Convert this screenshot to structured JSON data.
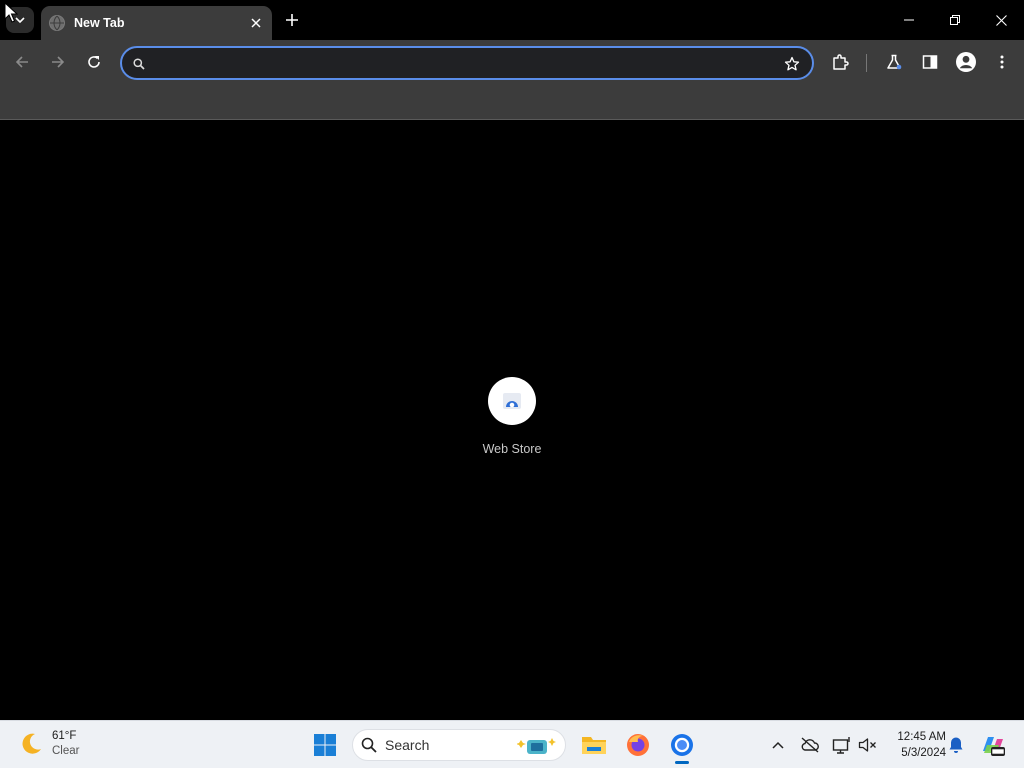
{
  "browser": {
    "tab": {
      "title": "New Tab"
    },
    "omnibox": {
      "value": "",
      "placeholder": ""
    }
  },
  "newtab": {
    "shortcuts": [
      {
        "label": "Web Store"
      }
    ]
  },
  "taskbar": {
    "weather": {
      "temp": "61°F",
      "condition": "Clear"
    },
    "search": {
      "label": "Search"
    },
    "clock": {
      "time": "12:45 AM",
      "date": "5/3/2024"
    }
  }
}
